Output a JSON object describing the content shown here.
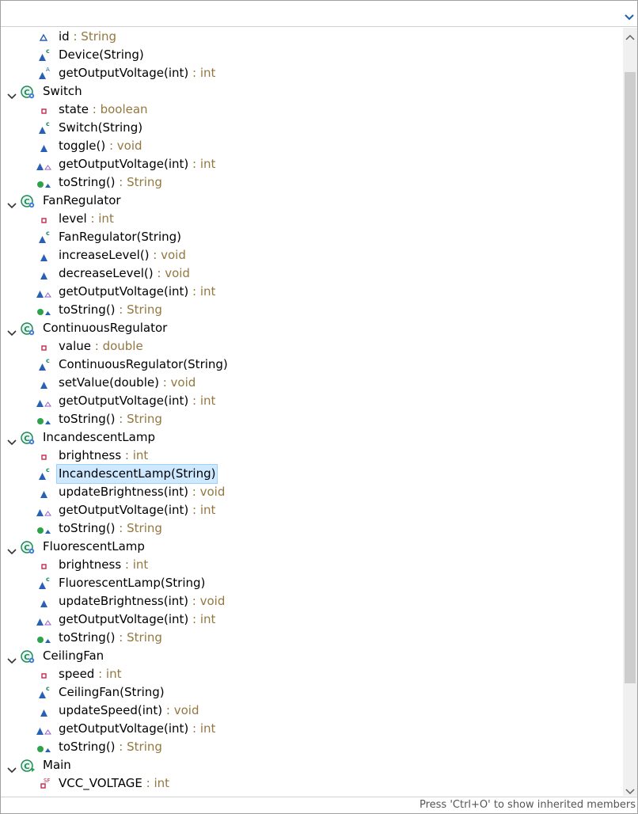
{
  "filter": {
    "value": "",
    "placeholder": ""
  },
  "status": {
    "hint": "Press 'Ctrl+O' to show inherited members"
  },
  "selected_row": 24,
  "colors": {
    "type_suffix": "#94773f",
    "selection_bg": "#cde8ff",
    "class_icon": "#1e8a5a",
    "method_icon": "#2860b5",
    "field_icon": "#c8274a"
  },
  "tree": [
    {
      "level": 1,
      "kind": "field-default",
      "name": "id",
      "type": "String",
      "icon": "hollow-triangle-icon"
    },
    {
      "level": 1,
      "kind": "constructor",
      "name": "Device(String)",
      "type": "",
      "icon": "constructor-icon"
    },
    {
      "level": 1,
      "kind": "abstract-method",
      "name": "getOutputVoltage(int)",
      "type": "int",
      "icon": "abstract-method-icon"
    },
    {
      "level": 0,
      "kind": "class",
      "name": "Switch",
      "type": "",
      "icon": "class-icon",
      "expanded": true
    },
    {
      "level": 1,
      "kind": "field-private",
      "name": "state",
      "type": "boolean",
      "icon": "private-field-icon"
    },
    {
      "level": 1,
      "kind": "constructor",
      "name": "Switch(String)",
      "type": "",
      "icon": "constructor-icon"
    },
    {
      "level": 1,
      "kind": "method",
      "name": "toggle()",
      "type": "void",
      "icon": "method-icon"
    },
    {
      "level": 1,
      "kind": "override-method",
      "name": "getOutputVoltage(int)",
      "type": "int",
      "icon": "implements-method-icon"
    },
    {
      "level": 1,
      "kind": "public-override",
      "name": "toString()",
      "type": "String",
      "icon": "overrides-method-icon"
    },
    {
      "level": 0,
      "kind": "class",
      "name": "FanRegulator",
      "type": "",
      "icon": "class-icon",
      "expanded": true
    },
    {
      "level": 1,
      "kind": "field-private",
      "name": "level",
      "type": "int",
      "icon": "private-field-icon"
    },
    {
      "level": 1,
      "kind": "constructor",
      "name": "FanRegulator(String)",
      "type": "",
      "icon": "constructor-icon"
    },
    {
      "level": 1,
      "kind": "method",
      "name": "increaseLevel()",
      "type": "void",
      "icon": "method-icon"
    },
    {
      "level": 1,
      "kind": "method",
      "name": "decreaseLevel()",
      "type": "void",
      "icon": "method-icon"
    },
    {
      "level": 1,
      "kind": "override-method",
      "name": "getOutputVoltage(int)",
      "type": "int",
      "icon": "implements-method-icon"
    },
    {
      "level": 1,
      "kind": "public-override",
      "name": "toString()",
      "type": "String",
      "icon": "overrides-method-icon"
    },
    {
      "level": 0,
      "kind": "class",
      "name": "ContinuousRegulator",
      "type": "",
      "icon": "class-icon",
      "expanded": true
    },
    {
      "level": 1,
      "kind": "field-private",
      "name": "value",
      "type": "double",
      "icon": "private-field-icon"
    },
    {
      "level": 1,
      "kind": "constructor",
      "name": "ContinuousRegulator(String)",
      "type": "",
      "icon": "constructor-icon"
    },
    {
      "level": 1,
      "kind": "method",
      "name": "setValue(double)",
      "type": "void",
      "icon": "method-icon"
    },
    {
      "level": 1,
      "kind": "override-method",
      "name": "getOutputVoltage(int)",
      "type": "int",
      "icon": "implements-method-icon"
    },
    {
      "level": 1,
      "kind": "public-override",
      "name": "toString()",
      "type": "String",
      "icon": "overrides-method-icon"
    },
    {
      "level": 0,
      "kind": "class",
      "name": "IncandescentLamp",
      "type": "",
      "icon": "class-icon",
      "expanded": true
    },
    {
      "level": 1,
      "kind": "field-private",
      "name": "brightness",
      "type": "int",
      "icon": "private-field-icon"
    },
    {
      "level": 1,
      "kind": "constructor",
      "name": "IncandescentLamp(String)",
      "type": "",
      "icon": "constructor-icon"
    },
    {
      "level": 1,
      "kind": "method",
      "name": "updateBrightness(int)",
      "type": "void",
      "icon": "method-icon"
    },
    {
      "level": 1,
      "kind": "override-method",
      "name": "getOutputVoltage(int)",
      "type": "int",
      "icon": "implements-method-icon"
    },
    {
      "level": 1,
      "kind": "public-override",
      "name": "toString()",
      "type": "String",
      "icon": "overrides-method-icon"
    },
    {
      "level": 0,
      "kind": "class",
      "name": "FluorescentLamp",
      "type": "",
      "icon": "class-icon",
      "expanded": true
    },
    {
      "level": 1,
      "kind": "field-private",
      "name": "brightness",
      "type": "int",
      "icon": "private-field-icon"
    },
    {
      "level": 1,
      "kind": "constructor",
      "name": "FluorescentLamp(String)",
      "type": "",
      "icon": "constructor-icon"
    },
    {
      "level": 1,
      "kind": "method",
      "name": "updateBrightness(int)",
      "type": "void",
      "icon": "method-icon"
    },
    {
      "level": 1,
      "kind": "override-method",
      "name": "getOutputVoltage(int)",
      "type": "int",
      "icon": "implements-method-icon"
    },
    {
      "level": 1,
      "kind": "public-override",
      "name": "toString()",
      "type": "String",
      "icon": "overrides-method-icon"
    },
    {
      "level": 0,
      "kind": "class",
      "name": "CeilingFan",
      "type": "",
      "icon": "class-icon",
      "expanded": true
    },
    {
      "level": 1,
      "kind": "field-private",
      "name": "speed",
      "type": "int",
      "icon": "private-field-icon"
    },
    {
      "level": 1,
      "kind": "constructor",
      "name": "CeilingFan(String)",
      "type": "",
      "icon": "constructor-icon"
    },
    {
      "level": 1,
      "kind": "method",
      "name": "updateSpeed(int)",
      "type": "void",
      "icon": "method-icon"
    },
    {
      "level": 1,
      "kind": "override-method",
      "name": "getOutputVoltage(int)",
      "type": "int",
      "icon": "implements-method-icon"
    },
    {
      "level": 1,
      "kind": "public-override",
      "name": "toString()",
      "type": "String",
      "icon": "overrides-method-icon"
    },
    {
      "level": 0,
      "kind": "main-class",
      "name": "Main",
      "type": "",
      "icon": "runnable-class-icon",
      "expanded": true
    },
    {
      "level": 1,
      "kind": "static-final-field",
      "name": "VCC_VOLTAGE",
      "type": "int",
      "icon": "static-final-field-icon"
    }
  ]
}
